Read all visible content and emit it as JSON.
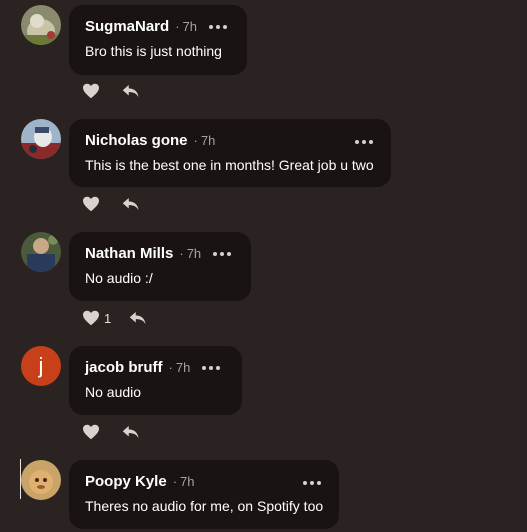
{
  "comments": [
    {
      "name": "SugmaNard",
      "time": "7h",
      "text": "Bro this is just nothing",
      "likes": ""
    },
    {
      "name": "Nicholas gone",
      "time": "7h",
      "text": "This is the best one in months! Great job u two",
      "likes": ""
    },
    {
      "name": "Nathan Mills",
      "time": "7h",
      "text": "No audio :/",
      "likes": "1"
    },
    {
      "name": "jacob bruff",
      "time": "7h",
      "text": "No audio",
      "likes": "",
      "avatar_letter": "j"
    },
    {
      "name": "Poopy Kyle",
      "time": "7h",
      "text": "Theres no audio for me, on Spotify too",
      "likes": ""
    }
  ],
  "icons": {
    "like": "heart-icon",
    "reply": "reply-arrow-icon",
    "more": "more-dots-icon"
  },
  "colors": {
    "background": "#2a2321",
    "bubble": "#191413",
    "letter_avatar": "#c8401a",
    "muted_text": "#a9a19d"
  }
}
